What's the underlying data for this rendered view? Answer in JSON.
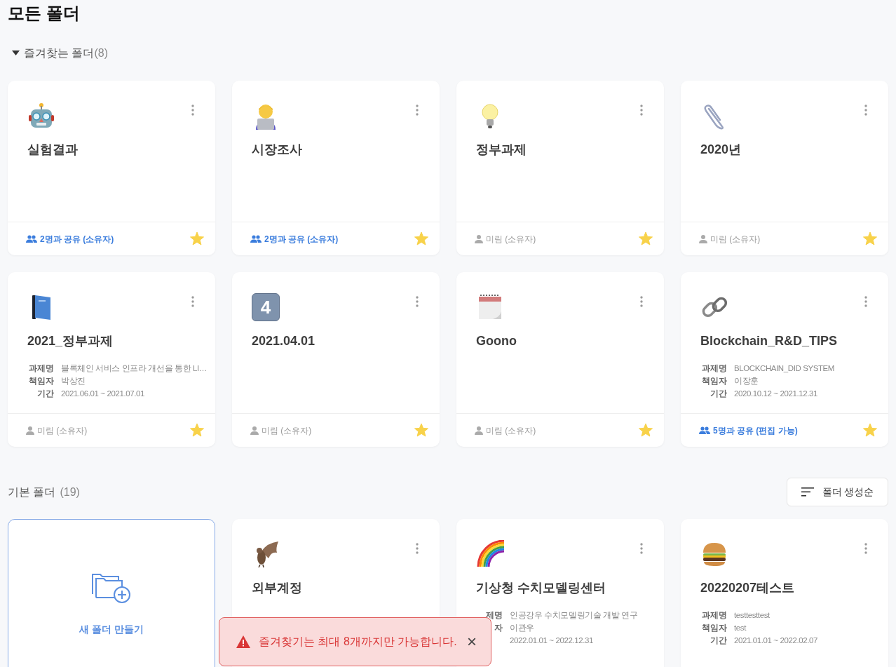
{
  "page_title": "모든 폴더",
  "favorites": {
    "title": "즐겨찾는 폴더",
    "count": "(8)",
    "expanded": true,
    "folders": [
      {
        "name": "실험결과",
        "sharing": {
          "shared": true,
          "text": "2명과 공유 (소유자)"
        },
        "starred": true
      },
      {
        "name": "시장조사",
        "sharing": {
          "shared": true,
          "text": "2명과 공유 (소유자)"
        },
        "starred": true
      },
      {
        "name": "정부과제",
        "sharing": {
          "shared": false,
          "text": "미림 (소유자)"
        },
        "starred": true
      },
      {
        "name": "2020년",
        "sharing": {
          "shared": false,
          "text": "미림 (소유자)"
        },
        "starred": true
      },
      {
        "name": "2021_정부과제",
        "details": [
          {
            "label": "과제명",
            "value": "블록체인 서비스 인프라 개선을 통한 LI…"
          },
          {
            "label": "책임자",
            "value": "박상진"
          },
          {
            "label": "기간",
            "value": "2021.06.01 ~ 2021.07.01"
          }
        ],
        "sharing": {
          "shared": false,
          "text": "미림 (소유자)"
        },
        "starred": true
      },
      {
        "name": "2021.04.01",
        "badge": "4",
        "sharing": {
          "shared": false,
          "text": "미림 (소유자)"
        },
        "starred": true
      },
      {
        "name": "Goono",
        "sharing": {
          "shared": false,
          "text": "미림 (소유자)"
        },
        "starred": true
      },
      {
        "name": "Blockchain_R&D_TIPS",
        "details": [
          {
            "label": "과제명",
            "value": "BLOCKCHAIN_DID SYSTEM"
          },
          {
            "label": "책임자",
            "value": "이장훈"
          },
          {
            "label": "기간",
            "value": "2020.10.12 ~ 2021.12.31"
          }
        ],
        "sharing": {
          "shared": true,
          "text": "5명과 공유 (편집 가능)"
        },
        "starred": true
      }
    ]
  },
  "basic": {
    "title": "기본 폴더",
    "count": "(19)",
    "sort_button": "폴더 생성순",
    "new_folder": "새 폴더 만들기",
    "folders": [
      {
        "name": "외부계정"
      },
      {
        "name": "기상청 수치모델링센터",
        "details": [
          {
            "label": "제명",
            "value": "인공강우 수치모델링기술 개발 연구"
          },
          {
            "label": "자",
            "value": "이관우"
          },
          {
            "value": "2022.01.01 ~ 2022.12.31"
          }
        ]
      },
      {
        "name": "20220207테스트",
        "details": [
          {
            "label": "과제명",
            "value": "testtesttest"
          },
          {
            "label": "책임자",
            "value": "test"
          },
          {
            "label": "기간",
            "value": "2021.01.01 ~ 2022.02.07"
          }
        ]
      }
    ]
  },
  "toast": {
    "message": "즐겨찾기는 최대 8개까지만 가능합니다.",
    "close": "×"
  }
}
